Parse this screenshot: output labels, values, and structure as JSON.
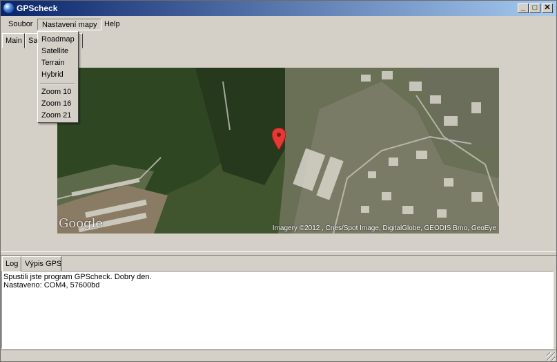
{
  "window": {
    "title": "GPScheck",
    "minimize": "_",
    "maximize": "□",
    "close": "✕"
  },
  "menubar": {
    "items": [
      "Soubor",
      "Nastavení mapy",
      "Help"
    ]
  },
  "map_menu": {
    "types": [
      "Roadmap",
      "Satellite",
      "Terrain",
      "Hybrid"
    ],
    "zooms": [
      "Zoom 10",
      "Zoom 16",
      "Zoom 21"
    ]
  },
  "top_tabs": [
    "Main",
    "Sat",
    ""
  ],
  "map": {
    "logo": "Google",
    "credit": "Imagery ©2012 , Cnes/Spot Image, DigitalGlobe, GEODIS Brno, GeoEye",
    "marker_color": "#e53935"
  },
  "bottom_tabs": [
    "Log",
    "Výpis GPS"
  ],
  "log": {
    "lines": [
      "Spustili jste program GPScheck. Dobry den.",
      "Nastaveno: COM4, 57600bd"
    ]
  },
  "colors": {
    "titlebar_start": "#0a246a",
    "titlebar_end": "#a6caf0",
    "face": "#d4d0c8"
  }
}
